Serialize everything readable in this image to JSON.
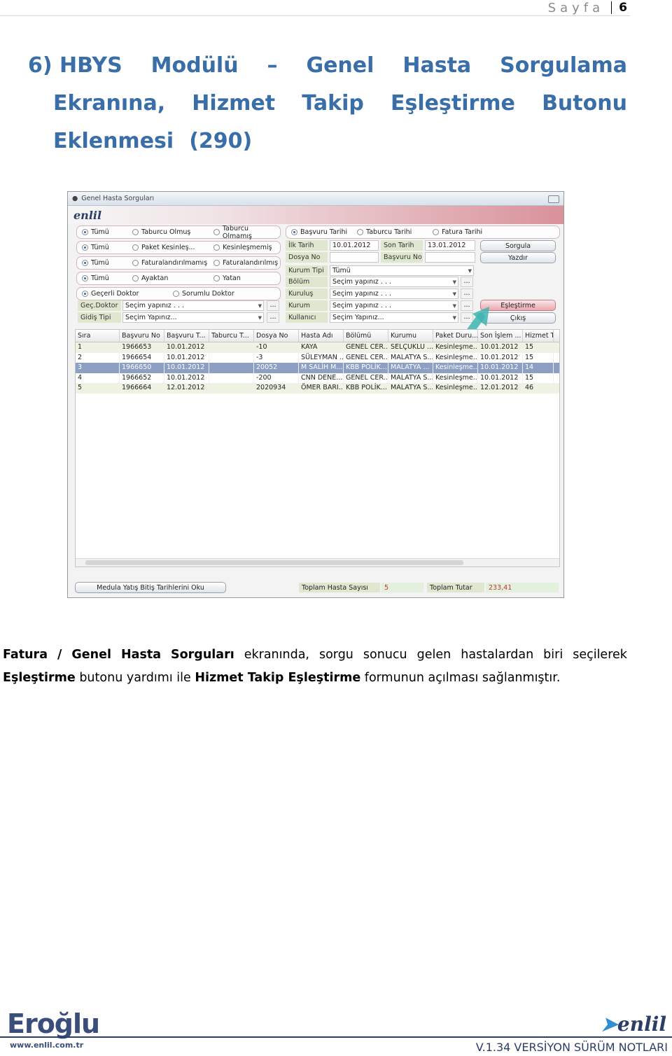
{
  "header": {
    "page_label": "Sayfa",
    "page_number": "6"
  },
  "heading": {
    "line1": [
      "6) HBYS",
      "Modülü",
      "–",
      "Genel",
      "Hasta",
      "Sorgulama"
    ],
    "line2": [
      "Ekranına,",
      "Hizmet",
      "Takip",
      "Eşleştirme",
      "Butonu"
    ],
    "line3": [
      "Eklenmesi",
      "(290)"
    ]
  },
  "app": {
    "window_title": "Genel Hasta Sorguları",
    "logo": "enlil",
    "radio_rows": [
      [
        "Tümü",
        "Taburcu Olmuş",
        "Taburcu Olmamış"
      ],
      [
        "Tümü",
        "Paket Kesinleş...",
        "Kesinleşmemiş"
      ],
      [
        "Tümü",
        "Faturalandırılmamış",
        "Faturalandırılmış"
      ],
      [
        "Tümü",
        "Ayaktan",
        "Yatan"
      ],
      [
        "Geçerli Doktor",
        "Sorumlu Doktor"
      ]
    ],
    "date_radio": [
      "Başvuru Tarihi",
      "Taburcu Tarihi",
      "Fatura Tarihi"
    ],
    "left_fields": [
      {
        "label": "Geç.Doktor",
        "value": "Seçim yapınız . . ."
      },
      {
        "label": "Gidiş Tipi",
        "value": "Seçim Yapınız..."
      }
    ],
    "filters": {
      "ilk_tarih_label": "İlk Tarih",
      "ilk_tarih_value": "10.01.2012",
      "son_tarih_label": "Son Tarih",
      "son_tarih_value": "13.01.2012",
      "dosya_no_label": "Dosya No",
      "basvuru_no_label": "Başvuru No",
      "kurum_tipi_label": "Kurum Tipi",
      "kurum_tipi_value": "Tümü",
      "bolum_label": "Bölüm",
      "bolum_value": "Seçim yapınız . . .",
      "kurulus_label": "Kuruluş",
      "kurulus_value": "Seçim yapınız . . .",
      "kurum_label": "Kurum",
      "kurum_value": "Seçim yapınız . . .",
      "kullanici_label": "Kullanıcı",
      "kullanici_value": "Seçim Yapınız..."
    },
    "dots": "...",
    "buttons": {
      "sorgula": "Sorgula",
      "yazdir": "Yazdır",
      "eslestirme": "Eşleştirme",
      "cikis": "Çıkış"
    },
    "grid": {
      "columns": [
        "Sıra",
        "Başvuru No",
        "Başvuru T...",
        "Taburcu T...",
        "Dosya No",
        "Hasta Adı",
        "Bölümü",
        "Kurumu",
        "Paket Duru...",
        "Son İşlem ...",
        "Hizmet Tu"
      ],
      "rows": [
        [
          "1",
          "1966653",
          "10.01.2012",
          "",
          "-10",
          "KAYA",
          "GENEL CER...",
          "SELÇUKLU ...",
          "Kesinleşme...",
          "10.01.2012",
          "15"
        ],
        [
          "2",
          "1966654",
          "10.01.2012",
          "",
          "-3",
          "SÜLEYMAN ...",
          "GENEL CER...",
          "MALATYA S...",
          "Kesinleşme...",
          "10.01.2012",
          "15"
        ],
        [
          "3",
          "1966650",
          "10.01.2012",
          "",
          "20052",
          "M SALİH M...",
          "KBB POLİK...",
          "MALATYA ...",
          "Kesinleşme...",
          "10.01.2012",
          "14"
        ],
        [
          "4",
          "1966652",
          "10.01.2012",
          "",
          "-200",
          "CNN DENE...",
          "GENEL CER...",
          "MALATYA S...",
          "Kesinleşme...",
          "10.01.2012",
          "15"
        ],
        [
          "5",
          "1966664",
          "12.01.2012",
          "",
          "2020934",
          "ÖMER BARI...",
          "KBB POLİK...",
          "MALATYA S...",
          "Kesinleşme...",
          "12.01.2012",
          "46"
        ]
      ],
      "selected_row": 3
    },
    "footer": {
      "medula_button": "Medula Yatış Bitiş Tarihlerini Oku",
      "toplam_hasta_label": "Toplam Hasta Sayısı",
      "toplam_hasta_value": "5",
      "toplam_tutar_label": "Toplam Tutar",
      "toplam_tutar_value": "233,41"
    },
    "colors": {
      "accent": "#d9919a",
      "selected_row": "#8da0c4",
      "arrow": "#3fb5b0"
    }
  },
  "caption": {
    "line1": [
      "Fatura",
      "/",
      "Genel",
      "Hasta",
      "Sorguları",
      "ekranında,",
      "sorgu",
      "sonucu",
      "gelen",
      "hastalardan",
      "biri",
      "seçilerek"
    ],
    "line2_bold1": "Eşleştirme",
    "line2_text1": " butonu yardımı ile ",
    "line2_bold2": "Hizmet Takip Eşleştirme",
    "line2_text2": " formunun açılması sağlanmıştır."
  },
  "footer": {
    "left_logo": "Eroğlu",
    "url": "www.enlil.com.tr",
    "right_logo": "enlil",
    "version": "V.1.34 VERSİYON SÜRÜM NOTLARI"
  }
}
